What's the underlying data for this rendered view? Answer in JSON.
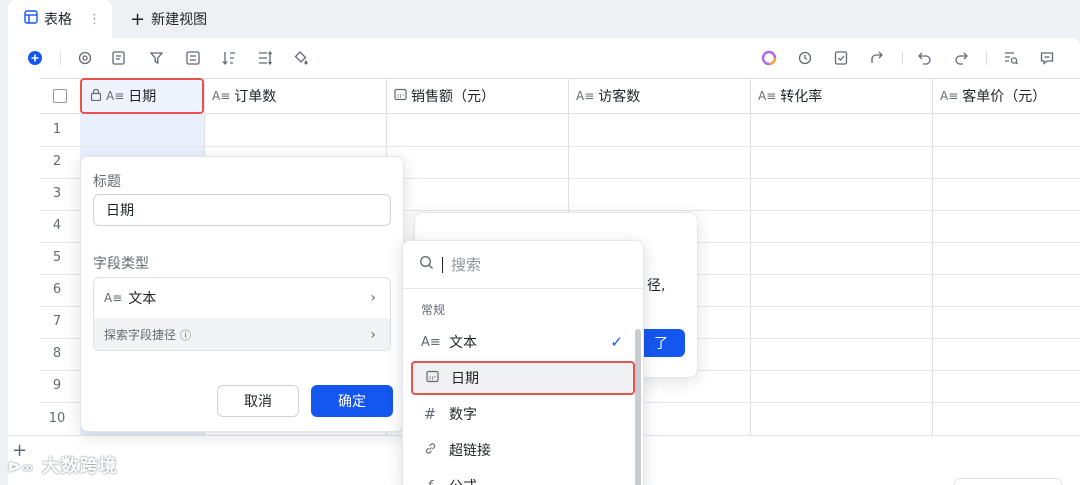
{
  "tabs": {
    "active_label": "表格",
    "more": "⋮",
    "new_label": "新建视图"
  },
  "toolbar": {
    "left_icons": [
      "add-record-icon",
      "settings-icon",
      "field-config-icon",
      "filter-icon",
      "group-icon",
      "sort-icon",
      "row-height-icon",
      "fill-color-icon"
    ],
    "right_icons": [
      "ai-icon",
      "automation-icon",
      "checklist-icon",
      "share-icon",
      "undo-icon",
      "redo-icon",
      "search-icon",
      "comment-icon"
    ]
  },
  "columns": [
    {
      "label": "日期",
      "type_icon": "A≡"
    },
    {
      "label": "订单数",
      "type_icon": "A≡"
    },
    {
      "label": "销售额（元）",
      "type_icon": "calendar"
    },
    {
      "label": "访客数",
      "type_icon": "A≡"
    },
    {
      "label": "转化率",
      "type_icon": "A≡"
    },
    {
      "label": "客单价（元）",
      "type_icon": "A≡"
    }
  ],
  "rows": [
    "1",
    "2",
    "3",
    "4",
    "5",
    "6",
    "7",
    "8",
    "9",
    "10"
  ],
  "field_panel": {
    "title_label": "标题",
    "title_value": "日期",
    "type_label": "字段类型",
    "type_value": "文本",
    "path_label": "探索字段捷径",
    "cancel": "取消",
    "confirm": "确定"
  },
  "behind_dialog": {
    "fragment": "径,",
    "button_fragment": "了"
  },
  "type_dropdown": {
    "search_placeholder": "搜索",
    "group": "常规",
    "items": [
      {
        "label": "文本",
        "icon": "text-icon",
        "checked": true
      },
      {
        "label": "日期",
        "icon": "calendar-icon",
        "highlighted": true
      },
      {
        "label": "数字",
        "icon": "number-icon"
      },
      {
        "label": "超链接",
        "icon": "link-icon"
      },
      {
        "label": "公式",
        "icon": "formula-icon"
      }
    ]
  },
  "watermark": "大数跨境",
  "colors": {
    "accent": "#1456f0",
    "highlight_box": "#e8534f",
    "selected_column": "#e9effd"
  }
}
